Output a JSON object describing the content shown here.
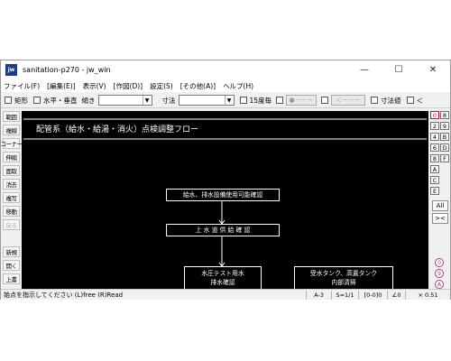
{
  "window": {
    "title": "sanitation-p270 - jw_win",
    "icon": "jw",
    "controls": {
      "minimize": "—",
      "maximize": "☐",
      "close": "✕"
    }
  },
  "menu": [
    "ファイル(F)",
    "[編集(E)]",
    "表示(V)",
    "[作図(D)]",
    "設定(S)",
    "[その他(A)]",
    "ヘルプ(H)"
  ],
  "toolbar": {
    "rect": "矩形",
    "hv": "水平・垂直",
    "angle": "傾き",
    "dim": "寸法",
    "every15": "15度毎",
    "btn_dot": "●－－－",
    "btn_arrow": "＜－－－",
    "dimval": "寸法値",
    "lt": "＜"
  },
  "left_tools": [
    {
      "label": "範囲",
      "enabled": true
    },
    {
      "label": "複線",
      "enabled": true
    },
    {
      "label": "コーナー",
      "enabled": true
    },
    {
      "label": "伸縮",
      "enabled": true
    },
    {
      "label": "面取",
      "enabled": true
    },
    {
      "label": "消去",
      "enabled": true
    },
    {
      "label": "複写",
      "enabled": true
    },
    {
      "label": "移動",
      "enabled": true
    },
    {
      "label": "戻る",
      "enabled": false
    },
    {
      "label": "新規",
      "enabled": true
    },
    {
      "label": "開く",
      "enabled": true
    },
    {
      "label": "上書",
      "enabled": true
    }
  ],
  "drawing": {
    "title": "配管系（給水・給湯・消火）点検調整フロー",
    "boxes": [
      {
        "lines": [
          "給水、排水設備使用可能確認"
        ]
      },
      {
        "lines": [
          "上 水 道 供 給 確 認"
        ]
      },
      {
        "lines": [
          "水圧テスト用水",
          "排水確認"
        ]
      },
      {
        "lines": [
          "受水タンク、高置タンク",
          "内部清掃"
        ]
      }
    ]
  },
  "layers": {
    "groups_left": [
      "0",
      "2",
      "4",
      "6",
      "8",
      "A",
      "C",
      "E"
    ],
    "groups_right": [
      "8",
      "9",
      "B",
      "D",
      "F"
    ],
    "all": "All",
    "cross": "><",
    "circles": [
      "0",
      "9",
      "A"
    ]
  },
  "status": {
    "message": "始点を指示してください (L)free (R)Read",
    "paper": "A-3",
    "scale": "S=1/1",
    "layer": "[0-0]0",
    "angle": "∠0",
    "zoom": "× 0.51"
  },
  "colors": {
    "canvas_bg": "#000000",
    "line": "#ffffff",
    "active_layer": "#e0003c"
  }
}
